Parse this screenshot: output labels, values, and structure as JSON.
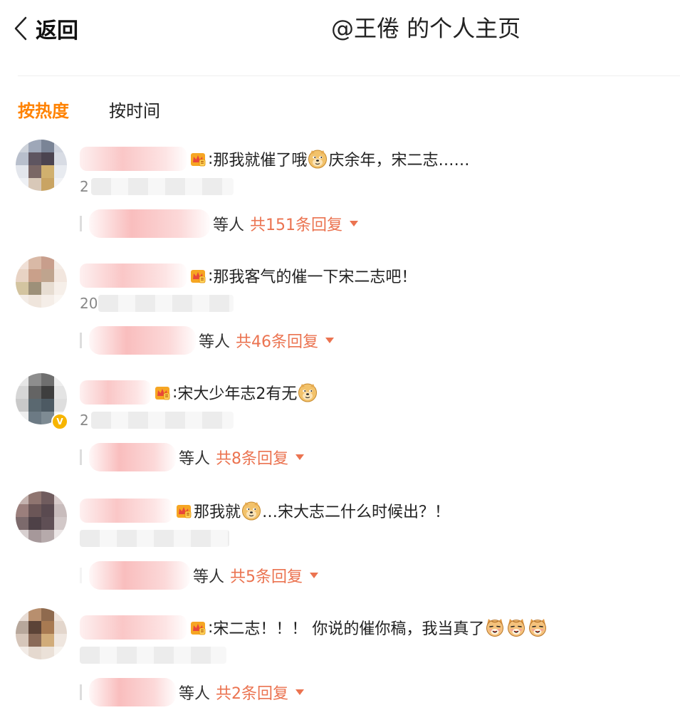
{
  "header": {
    "back_label": "返回",
    "title": "@王倦 的个人主页"
  },
  "tabs": [
    {
      "label": "按热度",
      "active": true
    },
    {
      "label": "按时间",
      "active": false
    }
  ],
  "colors": {
    "accent": "#ff8200",
    "reply_link": "#eb7350",
    "verified_badge": "#f7b500"
  },
  "comments": [
    {
      "text_parts": [
        "那我就催了哦",
        "庆余年，宋二志……"
      ],
      "time_visible": "2",
      "replies_suffix": "等人",
      "replies_count": "共151条回复"
    },
    {
      "text_parts": [
        "那我客气的催一下宋二志吧！"
      ],
      "time_visible": "20",
      "replies_suffix": "等人",
      "replies_count": "共46条回复"
    },
    {
      "text_parts": [
        "宋大少年志2有无"
      ],
      "time_visible": "2",
      "replies_suffix": "等人",
      "replies_count": "共8条回复"
    },
    {
      "text_parts": [
        "那我就",
        "…宋大志二什么时候出？！"
      ],
      "time_visible": "",
      "replies_suffix": "等人",
      "replies_count": "共5条回复"
    },
    {
      "text_parts": [
        "宋二志！！！ 你说的催你稿，我当真了"
      ],
      "time_visible": "",
      "replies_suffix": "等人",
      "replies_count": "共2条回复"
    }
  ]
}
